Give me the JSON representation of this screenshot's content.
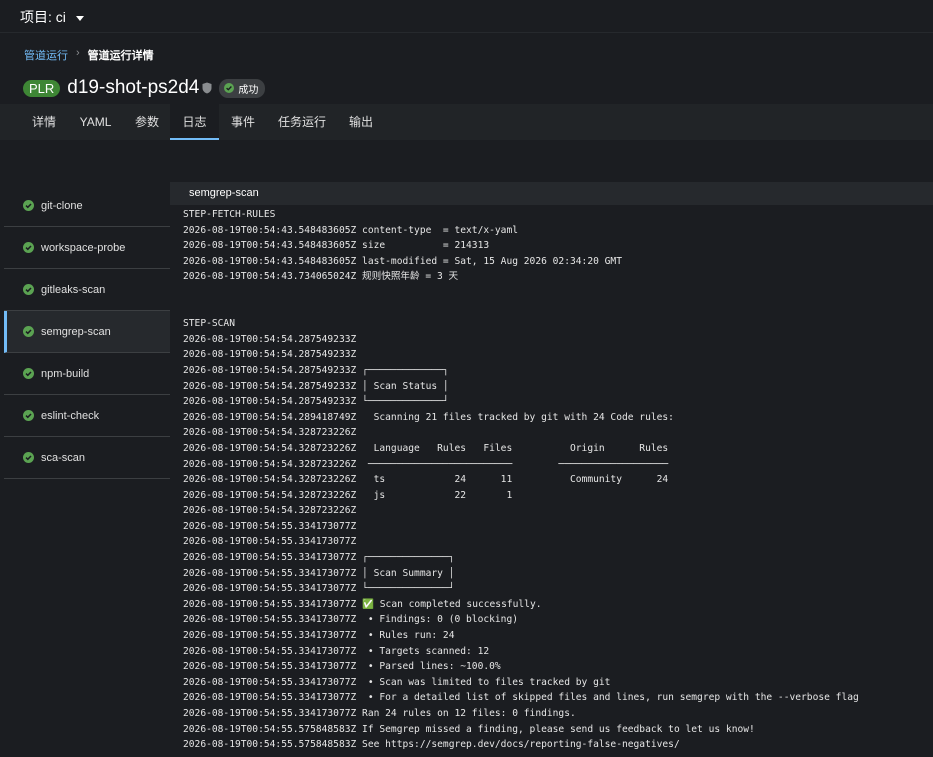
{
  "topbar": {
    "project_label": "项目: ci"
  },
  "breadcrumb": {
    "parent": "管道运行",
    "current": "管道运行详情"
  },
  "header": {
    "badge": "PLR",
    "name": "d19-shot-ps2d4",
    "status": "成功"
  },
  "tabs": [
    "详情",
    "YAML",
    "参数",
    "日志",
    "事件",
    "任务运行",
    "输出"
  ],
  "active_tab": "日志",
  "steps": [
    "git-clone",
    "workspace-probe",
    "gitleaks-scan",
    "semgrep-scan",
    "npm-build",
    "eslint-check",
    "sca-scan"
  ],
  "active_step": "semgrep-scan",
  "log": {
    "title": "semgrep-scan",
    "lines": [
      "STEP-FETCH-RULES",
      "2026-08-19T00:54:43.548483605Z content-type  = text/x-yaml",
      "2026-08-19T00:54:43.548483605Z size          = 214313",
      "2026-08-19T00:54:43.548483605Z last-modified = Sat, 15 Aug 2026 02:34:20 GMT",
      "2026-08-19T00:54:43.734065024Z 规则快照年龄 = 3 天",
      "",
      "",
      "STEP-SCAN",
      "2026-08-19T00:54:54.287549233Z",
      "2026-08-19T00:54:54.287549233Z",
      "2026-08-19T00:54:54.287549233Z ┌─────────────┐",
      "2026-08-19T00:54:54.287549233Z │ Scan Status │",
      "2026-08-19T00:54:54.287549233Z └─────────────┘",
      "2026-08-19T00:54:54.289418749Z   Scanning 21 files tracked by git with 24 Code rules:",
      "2026-08-19T00:54:54.328723226Z",
      "2026-08-19T00:54:54.328723226Z   Language   Rules   Files          Origin      Rules",
      "2026-08-19T00:54:54.328723226Z  ─────────────────────────        ───────────────────",
      "2026-08-19T00:54:54.328723226Z   ts            24      11          Community      24",
      "2026-08-19T00:54:54.328723226Z   js            22       1",
      "2026-08-19T00:54:54.328723226Z",
      "2026-08-19T00:54:55.334173077Z",
      "2026-08-19T00:54:55.334173077Z",
      "2026-08-19T00:54:55.334173077Z ┌──────────────┐",
      "2026-08-19T00:54:55.334173077Z │ Scan Summary │",
      "2026-08-19T00:54:55.334173077Z └──────────────┘",
      "2026-08-19T00:54:55.334173077Z ✅ Scan completed successfully.",
      "2026-08-19T00:54:55.334173077Z  • Findings: 0 (0 blocking)",
      "2026-08-19T00:54:55.334173077Z  • Rules run: 24",
      "2026-08-19T00:54:55.334173077Z  • Targets scanned: 12",
      "2026-08-19T00:54:55.334173077Z  • Parsed lines: ~100.0%",
      "2026-08-19T00:54:55.334173077Z  • Scan was limited to files tracked by git",
      "2026-08-19T00:54:55.334173077Z  • For a detailed list of skipped files and lines, run semgrep with the --verbose flag",
      "2026-08-19T00:54:55.334173077Z Ran 24 rules on 12 files: 0 findings.",
      "2026-08-19T00:54:55.575848583Z If Semgrep missed a finding, please send us feedback to let us know!",
      "2026-08-19T00:54:55.575848583Z See https://semgrep.dev/docs/reporting-false-negatives/"
    ]
  },
  "colors": {
    "accent": "#73bcf7",
    "success": "#3e8635",
    "success_icon": "#5ba352",
    "background": "#1b1d21"
  }
}
